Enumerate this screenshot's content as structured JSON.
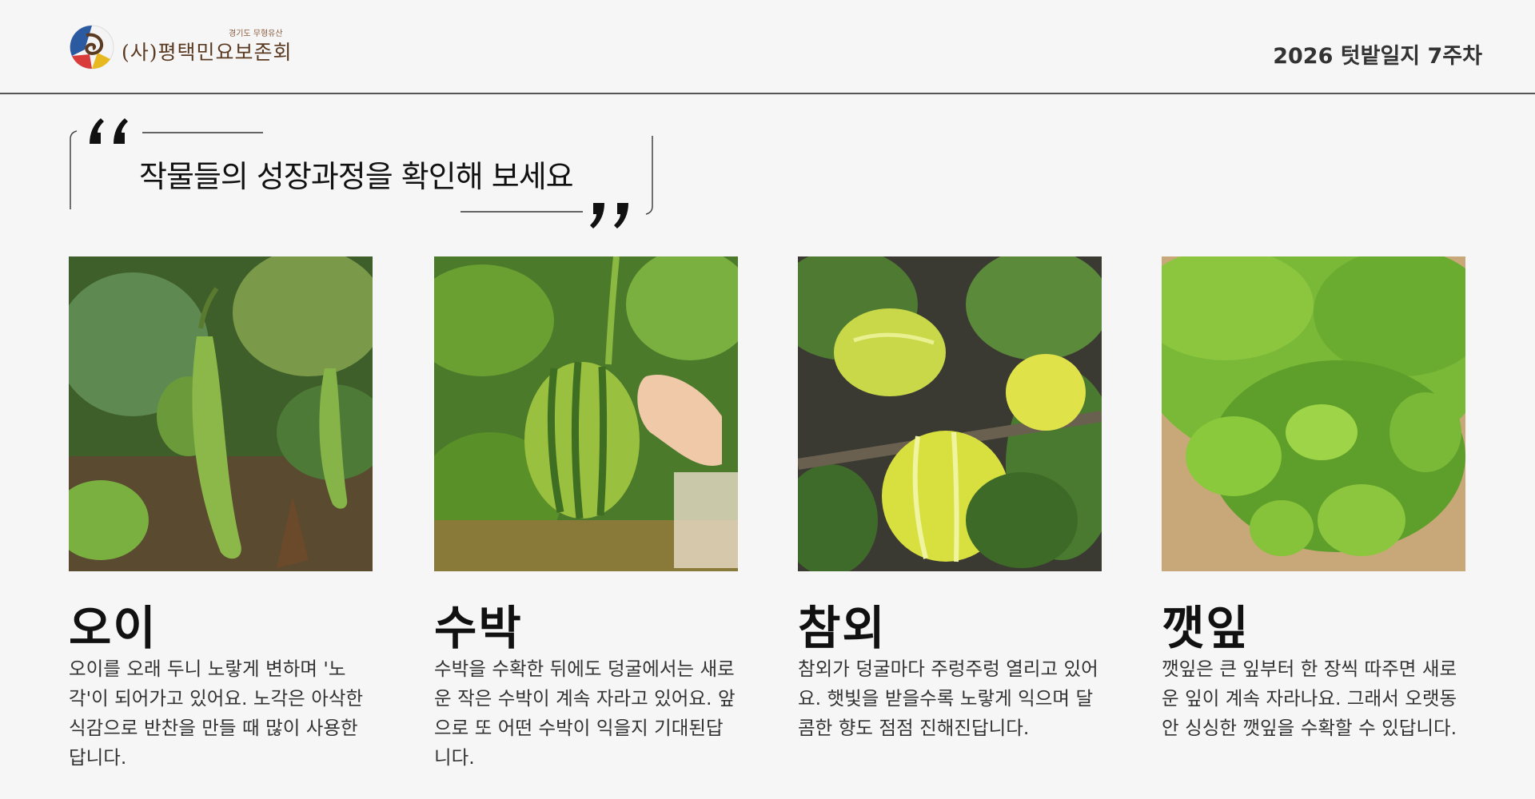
{
  "header": {
    "org_sub": "경기도 무형유산",
    "org_name": "(사)평택민요보존회",
    "logo_icon": "org-emblem-icon",
    "week_title": "2026 텃밭일지 7주차"
  },
  "quote": {
    "text": "작물들의 성장과정을 확인해 보세요",
    "open_icon": "open-quote-icon",
    "close_icon": "close-quote-icon"
  },
  "crops": [
    {
      "name": "오이",
      "description": "오이를 오래 두니 노랗게 변하며 '노각'이 되어가고 있어요. 노각은 아삭한 식감으로 반찬을 만들 때 많이 사용한답니다.",
      "photo": "cucumber-photo"
    },
    {
      "name": "수박",
      "description": "수박을 수확한 뒤에도 덩굴에서는 새로운 작은 수박이 계속 자라고 있어요. 앞으로 또 어떤 수박이 익을지 기대된답니다.",
      "photo": "watermelon-photo"
    },
    {
      "name": "참외",
      "description": "참외가 덩굴마다 주렁주렁 열리고 있어요. 햇빛을 받을수록 노랗게 익으며 달콤한 향도 점점 진해진답니다.",
      "photo": "korean-melon-photo"
    },
    {
      "name": "깻잎",
      "description": "깻잎은 큰 잎부터 한 장씩 따주면 새로운 잎이 계속 자라나요. 그래서 오랫동안 싱싱한 깻잎을 수확할 수 있답니다.",
      "photo": "perilla-photo"
    }
  ],
  "colors": {
    "background": "#f6f6f6",
    "text": "#222222",
    "leaf_dark": "#3f6b2a",
    "leaf_light": "#8cc63f",
    "melon_yellow": "#d8e040"
  }
}
